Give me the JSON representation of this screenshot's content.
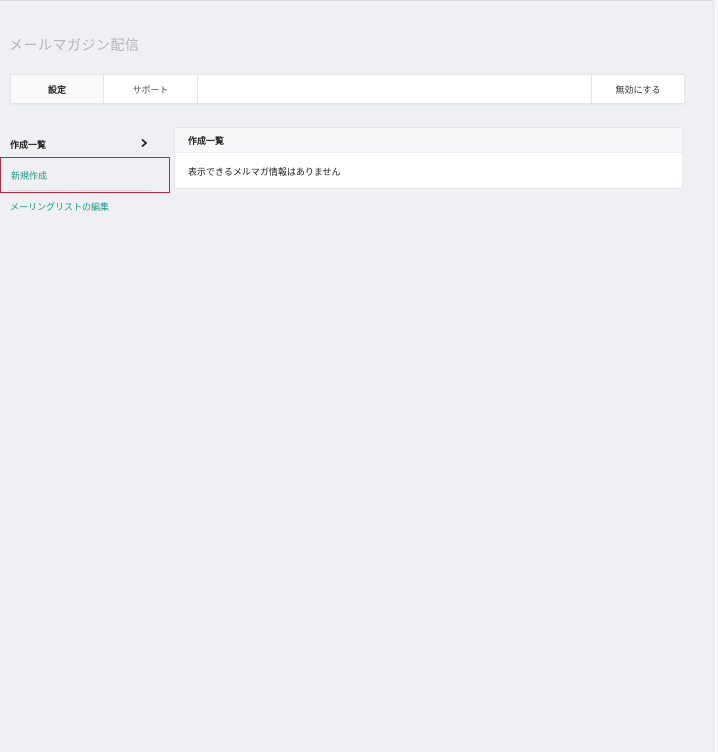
{
  "page": {
    "title": "メールマガジン配信"
  },
  "toolbar": {
    "settings_label": "設定",
    "support_label": "サポート",
    "disable_label": "無効にする"
  },
  "sidebar": {
    "items": [
      {
        "label": "作成一覧"
      },
      {
        "label": "新規作成"
      },
      {
        "label": "メーリングリストの編集"
      }
    ]
  },
  "panel": {
    "header": "作成一覧",
    "empty_message": "表示できるメルマガ情報はありません"
  },
  "colors": {
    "background": "#eff0f4",
    "link": "#1a9a85",
    "highlight_border": "#c2243b"
  },
  "icons": {
    "list_chevron": "chevron-right-icon"
  }
}
